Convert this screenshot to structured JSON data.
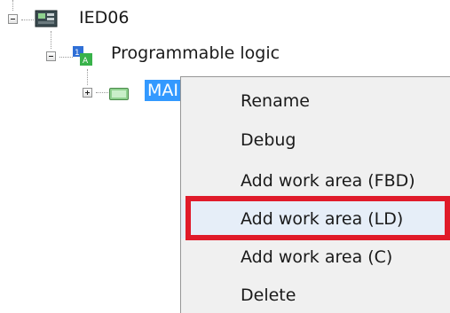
{
  "tree": {
    "root": {
      "label": "IED06",
      "icon": "ied-device-icon"
    },
    "child": {
      "label": "Programmable logic",
      "icon": "programmable-logic-icon"
    },
    "grandchild": {
      "label": "MAI",
      "icon": "logic-folder-icon",
      "selected": true
    }
  },
  "context_menu": {
    "items": [
      {
        "label": "Rename"
      },
      {
        "label": "Debug"
      },
      {
        "label": "Add work area (FBD)"
      },
      {
        "label": "Add work area (LD)",
        "highlighted": true
      },
      {
        "label": "Add work area (C)"
      },
      {
        "label": "Delete"
      }
    ]
  },
  "colors": {
    "selection": "#3399ff",
    "menu_background": "#f0f0f0",
    "annotation_box": "#e01b2a"
  }
}
